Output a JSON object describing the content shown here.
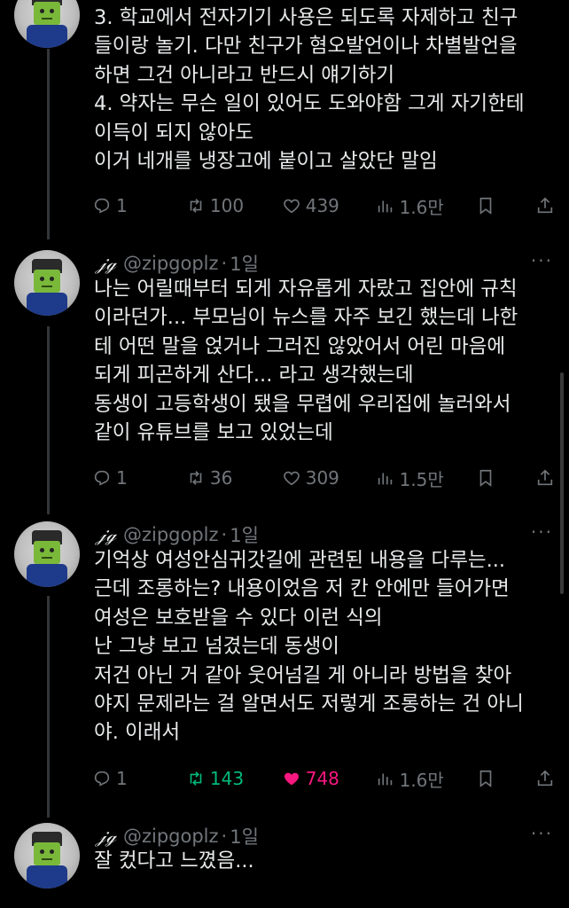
{
  "tweets": [
    {
      "lines": [
        "3. 학교에서 전자기기 사용은 되도록 자제하고 친구",
        "들이랑 놀기. 다만 친구가 혐오발언이나 차별발언을",
        "하면 그건 아니라고 반드시 얘기하기",
        "4. 약자는 무슨 일이 있어도 도와야함 그게 자기한테",
        "이득이 되지 않아도",
        "이거 네개를 냉장고에 붙이고 살았단 말임"
      ],
      "replies": "1",
      "retweets": "100",
      "likes": "439",
      "views": "1.6만"
    },
    {
      "name": "𝒿ℊ",
      "handle": "@zipgoplz",
      "sep": "·",
      "time": "1일",
      "lines": [
        "나는 어릴때부터 되게 자유롭게 자랐고 집안에 규칙",
        "이라던가... 부모님이 뉴스를 자주 보긴 했는데 나한",
        "테 어떤 말을 얹거나 그러진 않았어서 어린 마음에",
        "되게 피곤하게 산다... 라고 생각했는데",
        "동생이 고등학생이 됐을 무렵에 우리집에 놀러와서",
        "같이 유튜브를 보고 있었는데"
      ],
      "replies": "1",
      "retweets": "36",
      "likes": "309",
      "views": "1.5만"
    },
    {
      "name": "𝒿ℊ",
      "handle": "@zipgoplz",
      "sep": "·",
      "time": "1일",
      "lines": [
        "기억상 여성안심귀갓길에 관련된 내용을 다루는...",
        "근데 조롱하는? 내용이었음 저 칸 안에만 들어가면",
        "여성은 보호받을 수 있다 이런 식의",
        "난 그냥 보고 넘겼는데 동생이",
        "저건 아닌 거 같아 웃어넘길 게 아니라 방법을 찾아",
        "야지 문제라는 걸 알면서도 저렇게 조롱하는 건 아니",
        "야. 이래서"
      ],
      "replies": "1",
      "retweets": "143",
      "likes": "748",
      "views": "1.6만"
    },
    {
      "name": "𝒿ℊ",
      "handle": "@zipgoplz",
      "sep": "·",
      "time": "1일",
      "lines": [
        "잘 컸다고 느꼈음..."
      ]
    }
  ],
  "more_label": "···",
  "colors": {
    "retweet_active": "#00ba7c",
    "like_active": "#f91880",
    "muted": "#71767b"
  }
}
